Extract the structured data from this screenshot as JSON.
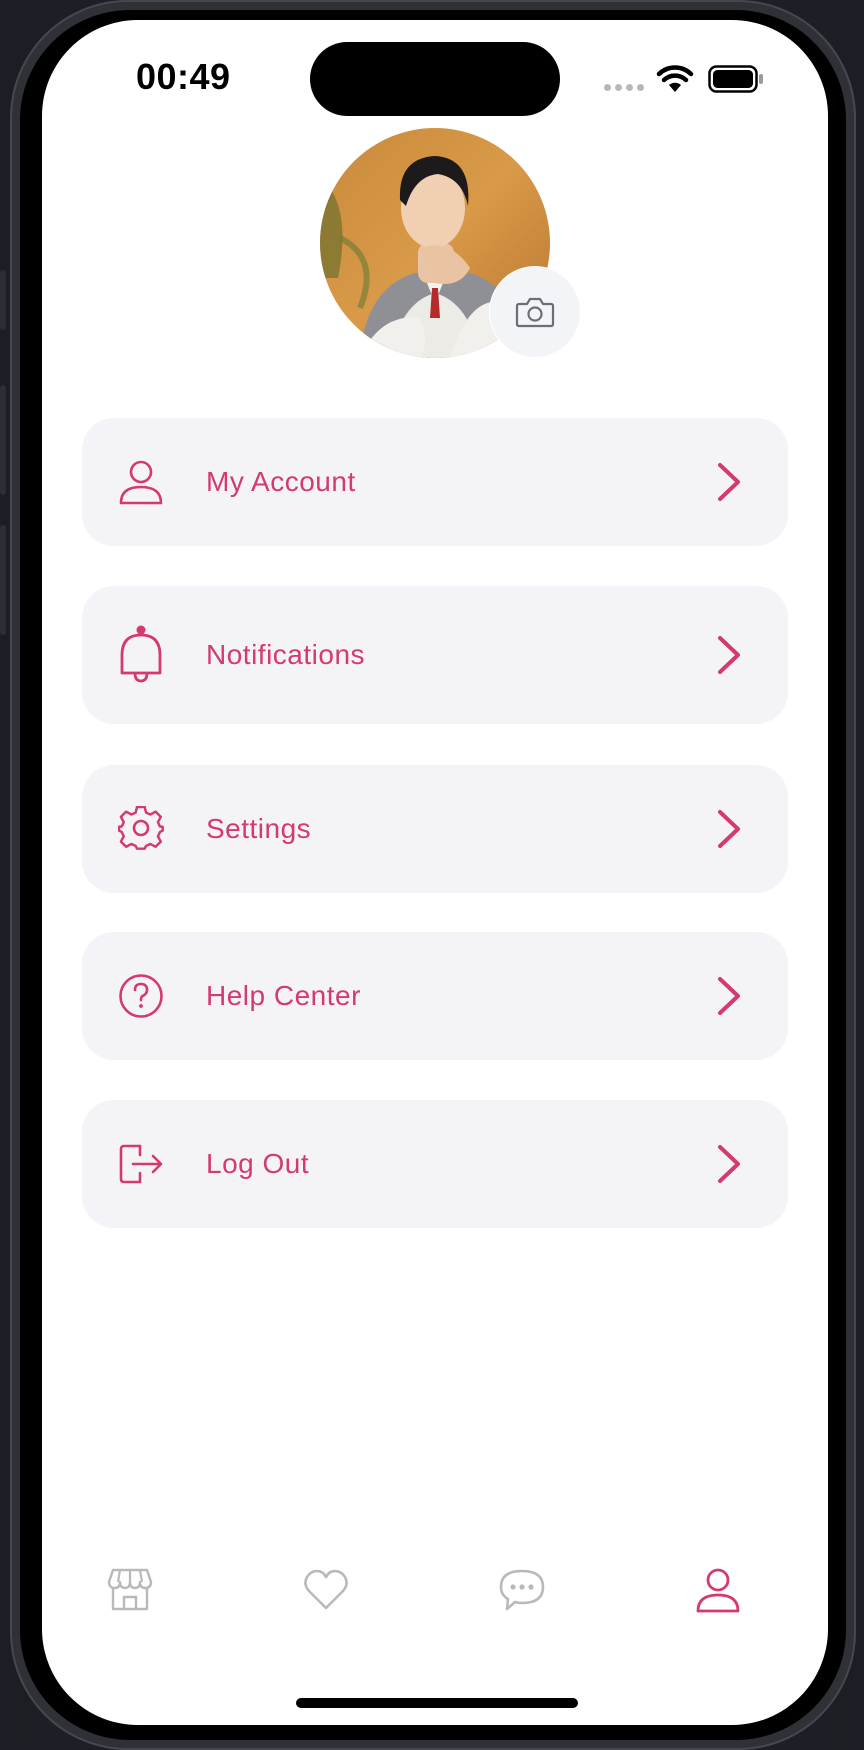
{
  "status_bar": {
    "time": "00:49"
  },
  "profile": {
    "avatar_alt": "",
    "camera_icon": "camera-icon"
  },
  "menu": [
    {
      "label": "My Account",
      "icon": "user-icon"
    },
    {
      "label": "Notifications",
      "icon": "bell-icon"
    },
    {
      "label": "Settings",
      "icon": "gear-icon"
    },
    {
      "label": "Help Center",
      "icon": "question-circle-icon"
    },
    {
      "label": "Log Out",
      "icon": "logout-icon"
    }
  ],
  "tabbar": {
    "tabs": [
      {
        "icon": "shop-icon",
        "active": false
      },
      {
        "icon": "heart-icon",
        "active": false
      },
      {
        "icon": "chat-icon",
        "active": false
      },
      {
        "icon": "user-icon",
        "active": true
      }
    ]
  },
  "colors": {
    "accent": "#d43a6e",
    "card_bg": "#f4f4f8",
    "inactive_icon": "#b9b9bd"
  }
}
